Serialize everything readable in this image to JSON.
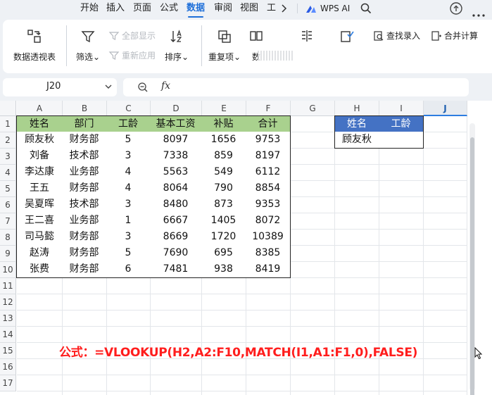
{
  "tabs": [
    "开始",
    "插入",
    "页面",
    "公式",
    "数据",
    "审阅",
    "视图",
    "工"
  ],
  "active_tab": "数据",
  "wps_ai_label": "WPS AI",
  "ribbon": {
    "pivot": "数据透视表",
    "filter": "筛选",
    "show_all": "全部显示",
    "reapply": "重新应用",
    "sort": "排序",
    "duplicates": "重复项",
    "data_partial": "数",
    "find_entry": "查找录入",
    "merge_calc": "合并计算"
  },
  "namebox": "J20",
  "fx_label": "fx",
  "columns": [
    "A",
    "B",
    "C",
    "D",
    "E",
    "F",
    "G",
    "H",
    "I",
    "J"
  ],
  "selected_column": "J",
  "rows": [
    "1",
    "2",
    "3",
    "4",
    "5",
    "6",
    "7",
    "8",
    "9",
    "10",
    "11",
    "12",
    "13",
    "14",
    "15",
    "16",
    "17"
  ],
  "table": {
    "headers": [
      "姓名",
      "部门",
      "工龄",
      "基本工资",
      "补贴",
      "合计"
    ],
    "data": [
      [
        "顾友秋",
        "财务部",
        "5",
        "8097",
        "1656",
        "9753"
      ],
      [
        "刘备",
        "技术部",
        "3",
        "7338",
        "859",
        "8197"
      ],
      [
        "李达康",
        "业务部",
        "4",
        "5563",
        "549",
        "6112"
      ],
      [
        "王五",
        "财务部",
        "4",
        "8064",
        "790",
        "8854"
      ],
      [
        "吴夏晖",
        "技术部",
        "3",
        "8480",
        "873",
        "9353"
      ],
      [
        "王二喜",
        "业务部",
        "1",
        "6667",
        "1405",
        "8072"
      ],
      [
        "司马懿",
        "财务部",
        "3",
        "8669",
        "1720",
        "10389"
      ],
      [
        "赵涛",
        "财务部",
        "5",
        "7690",
        "695",
        "8385"
      ],
      [
        "张费",
        "财务部",
        "6",
        "7481",
        "938",
        "8419"
      ]
    ]
  },
  "lookup": {
    "headers": [
      "姓名",
      "工龄"
    ],
    "values": [
      "顾友秋",
      ""
    ]
  },
  "formula_note": "公式：=VLOOKUP(H2,A2:F10,MATCH(I1,A1:F1,0),FALSE)",
  "colors": {
    "active_tab": "#1e6fd9",
    "header_green": "#a9d18e",
    "header_blue": "#4472c4",
    "formula_red": "#ff1d1d"
  }
}
